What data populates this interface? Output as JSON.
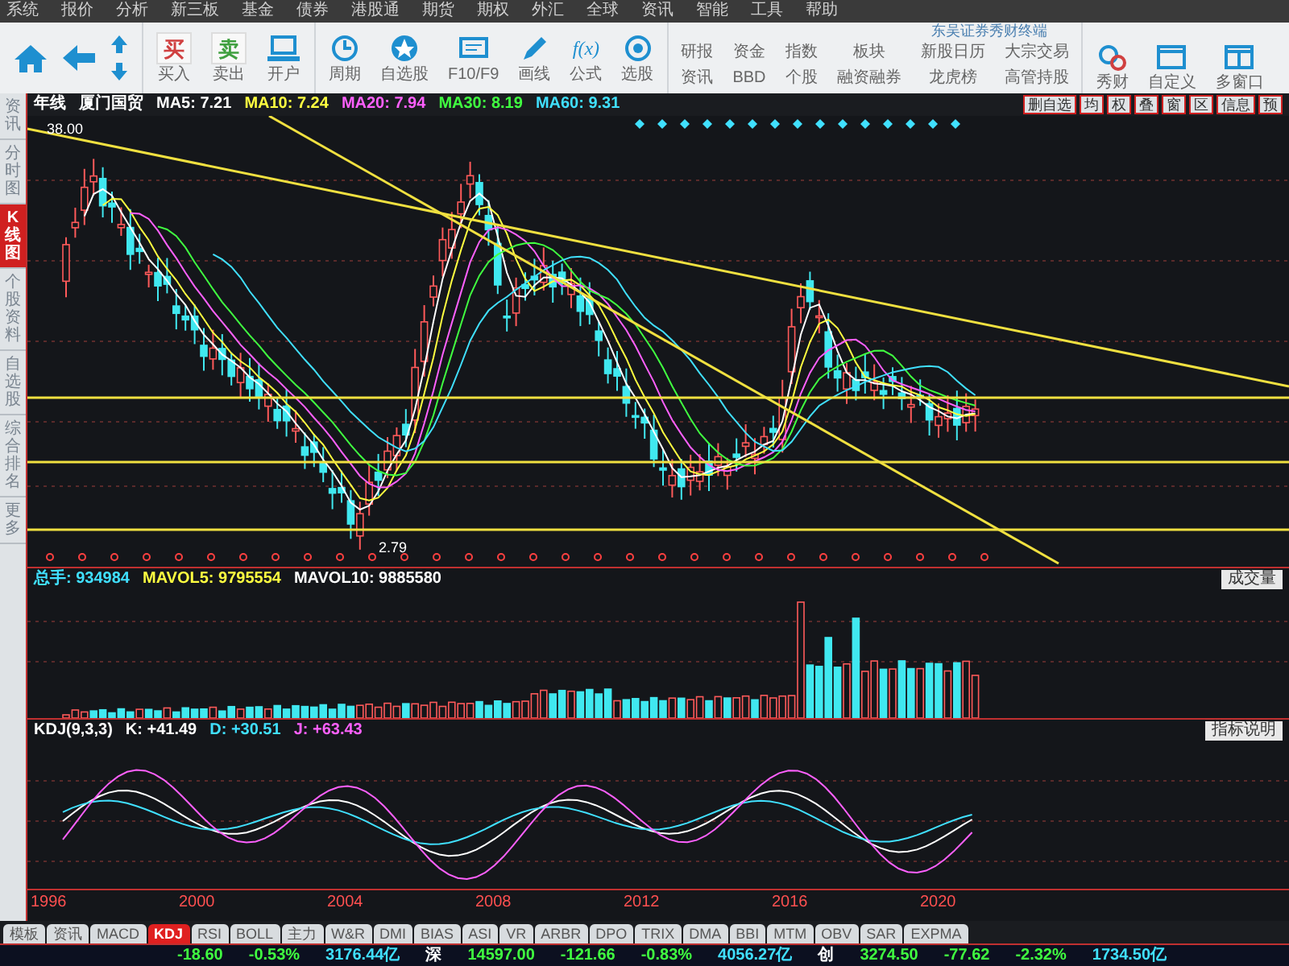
{
  "menu": [
    "系统",
    "报价",
    "分析",
    "新三板",
    "基金",
    "债券",
    "港股通",
    "期货",
    "期权",
    "外汇",
    "全球",
    "资讯",
    "智能",
    "工具",
    "帮助"
  ],
  "app_title": "东吴证券秀财终端",
  "trade_buttons": [
    {
      "glyph": "买",
      "label": "买入",
      "color": "#d04040"
    },
    {
      "glyph": "卖",
      "label": "卖出",
      "color": "#40a040"
    }
  ],
  "open_account": {
    "label": "开户"
  },
  "tool_buttons": [
    {
      "label": "周期",
      "kind": "clock"
    },
    {
      "label": "自选股",
      "kind": "star"
    },
    {
      "label": "F10/F9",
      "kind": "screen"
    },
    {
      "label": "画线",
      "kind": "pen"
    },
    {
      "label": "公式",
      "kind": "formula",
      "glyph": "f(x)"
    },
    {
      "label": "选股",
      "kind": "target"
    }
  ],
  "text_pairs": [
    [
      "研报",
      "资讯"
    ],
    [
      "资金",
      "BBD"
    ],
    [
      "指数",
      "个股"
    ],
    [
      "板块",
      "融资融券"
    ],
    [
      "新股日历",
      "龙虎榜"
    ],
    [
      "大宗交易",
      "高管持股"
    ]
  ],
  "extra_buttons": [
    {
      "label": "秀财",
      "kind": "gears"
    },
    {
      "label": "自定义",
      "kind": "window"
    },
    {
      "label": "多窗口",
      "kind": "windows"
    }
  ],
  "sidebar": [
    {
      "label": "资讯",
      "selected": false
    },
    {
      "label": "分时图",
      "selected": false
    },
    {
      "label": "K线图",
      "selected": true
    },
    {
      "label": "个股资料",
      "selected": false
    },
    {
      "label": "自选股",
      "selected": false
    },
    {
      "label": "综合排名",
      "selected": false
    },
    {
      "label": "更多",
      "selected": false
    }
  ],
  "chart": {
    "period": "年线",
    "stock": "厦门国贸",
    "ma": [
      {
        "label": "MA5: 7.21",
        "color": "#ffffff"
      },
      {
        "label": "MA10: 7.24",
        "color": "#ffff40"
      },
      {
        "label": "MA20: 7.94",
        "color": "#ff60ff"
      },
      {
        "label": "MA30: 8.19",
        "color": "#40ff40"
      },
      {
        "label": "MA60: 9.31",
        "color": "#40e0ff"
      }
    ],
    "tools": [
      "删自选",
      "均",
      "权",
      "叠",
      "窗",
      "区",
      "信息",
      "预"
    ],
    "high_label": "38.00",
    "low_label": "2.79"
  },
  "volume": {
    "header": [
      {
        "label": "总手: 934984",
        "color": "#40e0ff"
      },
      {
        "label": "MAVOL5: 9795554",
        "color": "#ffff40"
      },
      {
        "label": "MAVOL10: 9885580",
        "color": "#ffffff"
      }
    ],
    "dropdown": "成交量"
  },
  "kdj": {
    "header": [
      {
        "label": "KDJ(9,3,3)",
        "color": "#ffffff"
      },
      {
        "label": "K: +41.49",
        "color": "#ffffff"
      },
      {
        "label": "D: +30.51",
        "color": "#40e0ff"
      },
      {
        "label": "J: +63.43",
        "color": "#ff60ff"
      }
    ],
    "help": "指标说明"
  },
  "x_axis": [
    "1996",
    "2000",
    "2004",
    "2008",
    "2012",
    "2016",
    "2020"
  ],
  "indicator_tabs": [
    {
      "label": "模板",
      "selected": false
    },
    {
      "label": "资讯",
      "selected": false
    },
    {
      "label": "MACD",
      "selected": false
    },
    {
      "label": "KDJ",
      "selected": true
    },
    {
      "label": "RSI",
      "selected": false
    },
    {
      "label": "BOLL",
      "selected": false
    },
    {
      "label": "主力",
      "selected": false
    },
    {
      "label": "W&R",
      "selected": false
    },
    {
      "label": "DMI",
      "selected": false
    },
    {
      "label": "BIAS",
      "selected": false
    },
    {
      "label": "ASI",
      "selected": false
    },
    {
      "label": "VR",
      "selected": false
    },
    {
      "label": "ARBR",
      "selected": false
    },
    {
      "label": "DPO",
      "selected": false
    },
    {
      "label": "TRIX",
      "selected": false
    },
    {
      "label": "DMA",
      "selected": false
    },
    {
      "label": "BBI",
      "selected": false
    },
    {
      "label": "MTM",
      "selected": false
    },
    {
      "label": "OBV",
      "selected": false
    },
    {
      "label": "SAR",
      "selected": false
    },
    {
      "label": "EXPMA",
      "selected": false
    }
  ],
  "status_bar": [
    {
      "text": "-18.60",
      "color": "#40ff40"
    },
    {
      "text": "-0.53%",
      "color": "#40ff40"
    },
    {
      "text": "3176.44亿",
      "color": "#40e0ff"
    },
    {
      "text": "深",
      "color": "#ffffff"
    },
    {
      "text": "14597.00",
      "color": "#40ff40"
    },
    {
      "text": "-121.66",
      "color": "#40ff40"
    },
    {
      "text": "-0.83%",
      "color": "#40ff40"
    },
    {
      "text": "4056.27亿",
      "color": "#40e0ff"
    },
    {
      "text": "创",
      "color": "#ffffff"
    },
    {
      "text": "3274.50",
      "color": "#40ff40"
    },
    {
      "text": "-77.62",
      "color": "#40ff40"
    },
    {
      "text": "-2.32%",
      "color": "#40ff40"
    },
    {
      "text": "1734.50亿",
      "color": "#40e0ff"
    }
  ]
}
